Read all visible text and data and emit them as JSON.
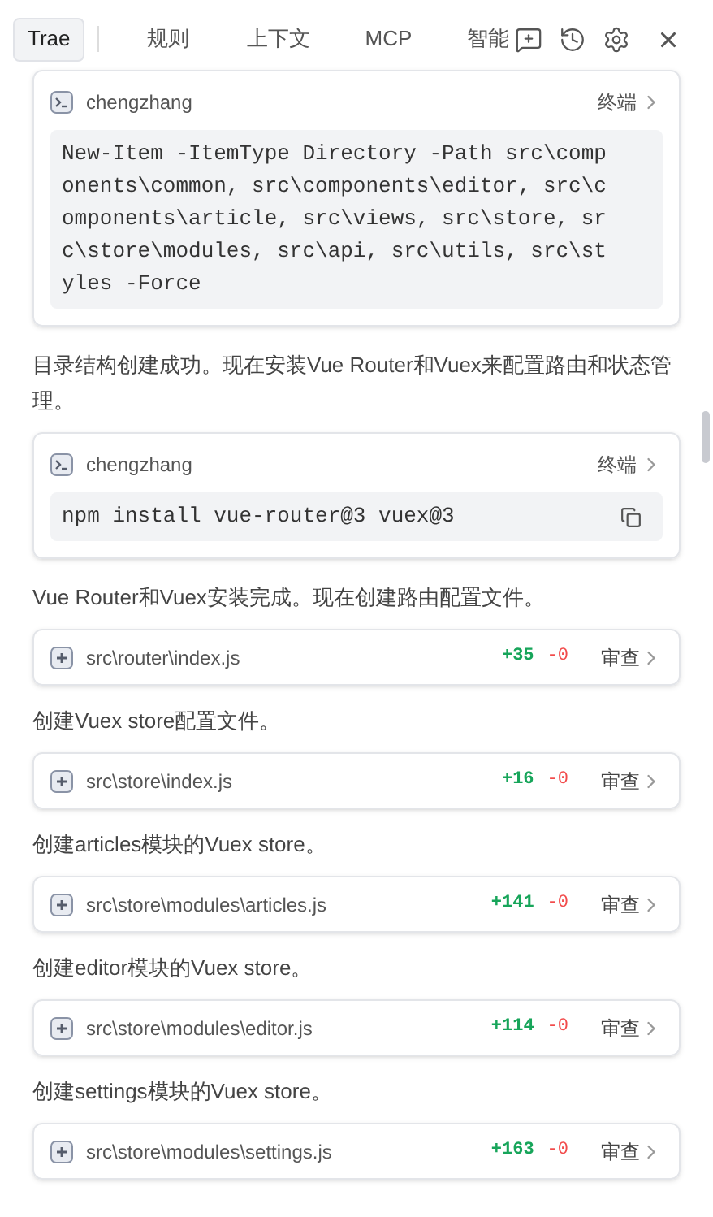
{
  "tabs": [
    {
      "label": "Trae",
      "selected": true
    },
    {
      "label": "规则",
      "selected": false
    },
    {
      "label": "上下文",
      "selected": false
    },
    {
      "label": "MCP",
      "selected": false
    },
    {
      "label": "智能",
      "selected": false
    }
  ],
  "feed": [
    {
      "kind": "terminal",
      "user": "chengzhang",
      "action": "终端",
      "command": "New-Item -ItemType Directory -Path src\\components\\common, src\\components\\editor, src\\components\\article, src\\views, src\\store, src\\store\\modules, src\\api, src\\utils, src\\styles -Force",
      "copy": false
    },
    {
      "kind": "text",
      "text": "目录结构创建成功。现在安装Vue Router和Vuex来配置路由和状态管理。"
    },
    {
      "kind": "terminal",
      "user": "chengzhang",
      "action": "终端",
      "command": "npm install vue-router@3 vuex@3",
      "copy": true
    },
    {
      "kind": "text",
      "text": "Vue Router和Vuex安装完成。现在创建路由配置文件。"
    },
    {
      "kind": "file",
      "path": "src\\router\\index.js",
      "added": "+35",
      "removed": "-0",
      "action": "审查"
    },
    {
      "kind": "text",
      "text": "创建Vuex store配置文件。"
    },
    {
      "kind": "file",
      "path": "src\\store\\index.js",
      "added": "+16",
      "removed": "-0",
      "action": "审查"
    },
    {
      "kind": "text",
      "text": "创建articles模块的Vuex store。"
    },
    {
      "kind": "file",
      "path": "src\\store\\modules\\articles.js",
      "added": "+141",
      "removed": "-0",
      "action": "审查"
    },
    {
      "kind": "text",
      "text": "创建editor模块的Vuex store。"
    },
    {
      "kind": "file",
      "path": "src\\store\\modules\\editor.js",
      "added": "+114",
      "removed": "-0",
      "action": "审查"
    },
    {
      "kind": "text",
      "text": "创建settings模块的Vuex store。"
    },
    {
      "kind": "file",
      "path": "src\\store\\modules\\settings.js",
      "added": "+163",
      "removed": "-0",
      "action": "审查"
    }
  ]
}
